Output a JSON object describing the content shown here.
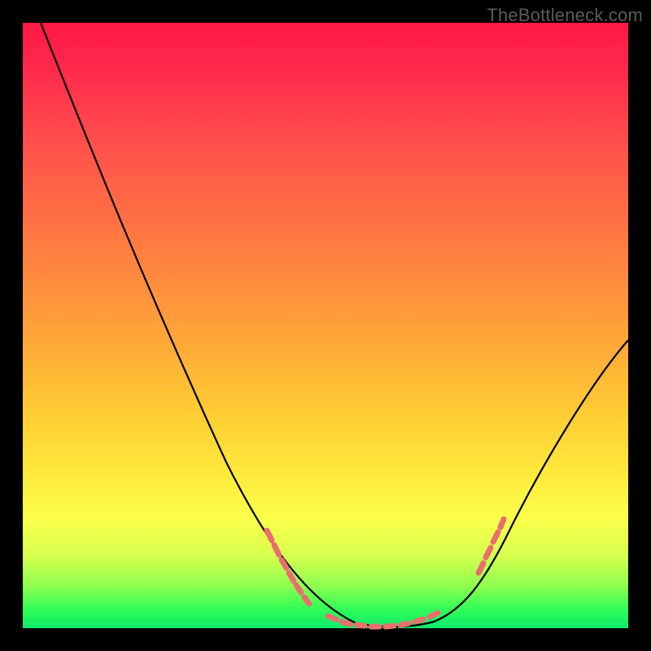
{
  "watermark": "TheBottleneck.com",
  "chart_data": {
    "type": "line",
    "title": "",
    "xlabel": "",
    "ylabel": "",
    "xlim": [
      0,
      100
    ],
    "ylim": [
      0,
      100
    ],
    "grid": false,
    "legend": false,
    "series": [
      {
        "name": "bottleneck-curve",
        "x": [
          3,
          10,
          20,
          30,
          40,
          46,
          50,
          54,
          58,
          62,
          66,
          70,
          74,
          80,
          88,
          96,
          100
        ],
        "values": [
          100,
          85,
          66,
          47,
          28,
          16,
          9,
          4,
          1,
          0,
          0,
          1,
          3,
          9,
          22,
          38,
          47
        ]
      }
    ],
    "highlight_points": {
      "name": "highlighted-region",
      "color": "#e96f6e",
      "x": [
        40,
        42,
        44,
        46,
        48,
        50,
        52,
        54,
        56,
        58,
        60,
        62,
        64,
        66,
        68,
        70,
        72,
        74,
        76,
        78,
        80,
        82
      ],
      "values": [
        28,
        24,
        20,
        16,
        12,
        9,
        6,
        4,
        2,
        1,
        0.5,
        0,
        0,
        0,
        0.5,
        1,
        2,
        3,
        5,
        7,
        9,
        12
      ]
    },
    "notes": "Axes unlabeled in source image; x and y are normalized 0-100. values represent approximate curve height as percentage of plot height (0 = bottom/green, 100 = top/red)."
  }
}
